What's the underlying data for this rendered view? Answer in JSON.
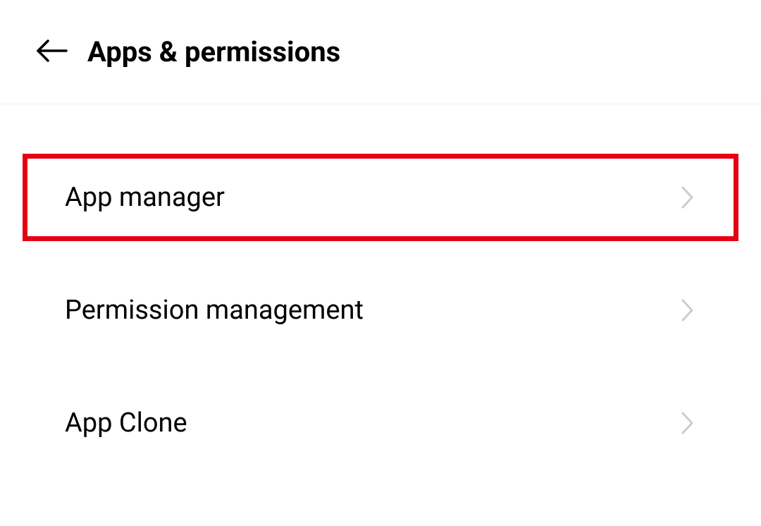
{
  "header": {
    "title": "Apps & permissions"
  },
  "items": [
    {
      "label": "App manager",
      "highlighted": true
    },
    {
      "label": "Permission management",
      "highlighted": false
    },
    {
      "label": "App Clone",
      "highlighted": false
    }
  ]
}
